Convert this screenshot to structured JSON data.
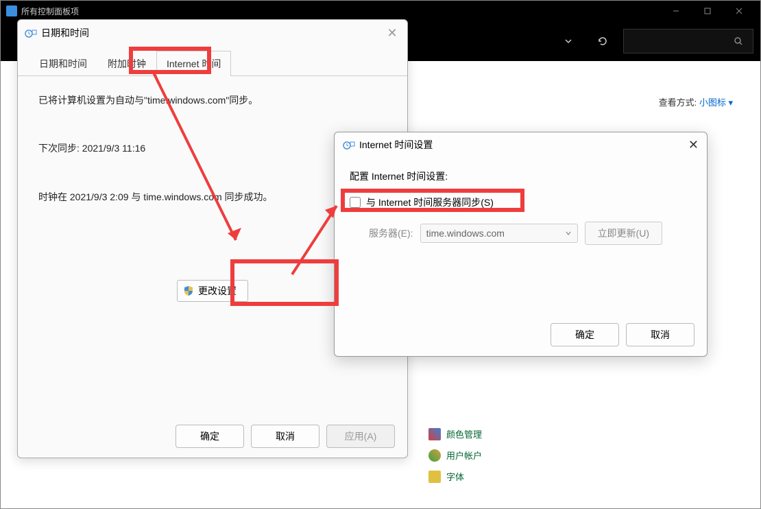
{
  "main_window": {
    "title": "所有控制面板项",
    "view_label": "查看方式:",
    "view_value": "小图标",
    "cp_links": {
      "color_mgmt": "颜色管理",
      "user_accounts": "用户帐户",
      "fonts": "字体"
    }
  },
  "dt_dialog": {
    "title": "日期和时间",
    "tabs": {
      "date_time": "日期和时间",
      "additional_clocks": "附加时钟",
      "internet_time": "Internet 时间"
    },
    "sync_info": "已将计算机设置为自动与\"time.windows.com\"同步。",
    "next_sync": "下次同步: 2021/9/3 11:16",
    "last_sync": "时钟在 2021/9/3 2:09 与 time.windows.com 同步成功。",
    "change_settings": "更改设置",
    "ok": "确定",
    "cancel": "取消",
    "apply": "应用(A)"
  },
  "its_dialog": {
    "title": "Internet 时间设置",
    "config_label": "配置 Internet 时间设置:",
    "sync_checkbox": "与 Internet 时间服务器同步(S)",
    "server_label": "服务器(E):",
    "server_value": "time.windows.com",
    "update_now": "立即更新(U)",
    "ok": "确定",
    "cancel": "取消"
  }
}
